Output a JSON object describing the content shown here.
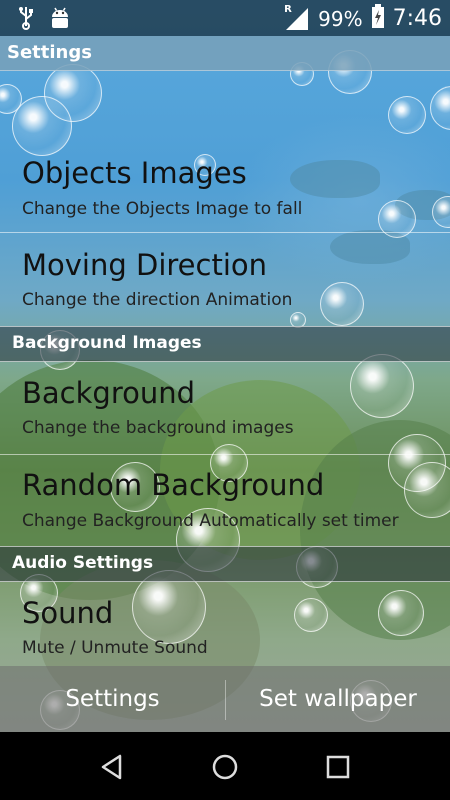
{
  "status_bar": {
    "icons_left": [
      "usb-icon",
      "android-debug-icon"
    ],
    "signal_label": "R",
    "battery": "99%",
    "time": "7:46"
  },
  "header": {
    "title": "Settings"
  },
  "sections": [
    {
      "items": [
        {
          "title": "Objects Images",
          "subtitle": "Change the Objects Image to fall"
        },
        {
          "title": "Moving Direction",
          "subtitle": "Change the direction Animation"
        }
      ]
    },
    {
      "header": "Background Images",
      "items": [
        {
          "title": "Background",
          "subtitle": "Change the background images"
        },
        {
          "title": "Random Background",
          "subtitle": "Change Background Automatically set timer"
        }
      ]
    },
    {
      "header": "Audio Settings",
      "items": [
        {
          "title": "Sound",
          "subtitle": "Mute / Unmute Sound"
        }
      ]
    }
  ],
  "bottom_bar": {
    "left_label": "Settings",
    "right_label": "Set wallpaper"
  },
  "nav_bar": {
    "icons": [
      "back-icon",
      "home-icon",
      "recents-icon"
    ]
  }
}
